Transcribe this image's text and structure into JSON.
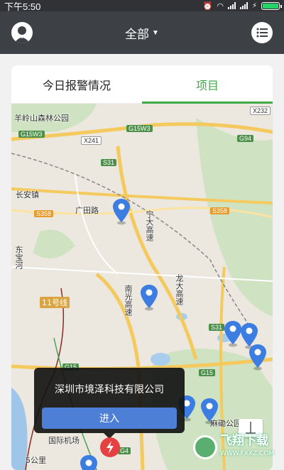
{
  "status_bar": {
    "time": "下午5:50"
  },
  "app_bar": {
    "title": "全部",
    "avatar_icon": "user-avatar-icon",
    "menu_icon": "list-icon"
  },
  "tabs": [
    {
      "label": "今日报警情况",
      "active": false
    },
    {
      "label": "项目",
      "active": true
    }
  ],
  "colors": {
    "accent": "#3fa84a",
    "appbar": "#3d4045",
    "button": "#4d7fd6",
    "pin": "#3b7de0",
    "alarm": "#e54042"
  },
  "map": {
    "labels": {
      "park": "羊岭山森林公园",
      "town": "长安镇",
      "road1": "广田路",
      "road2": "宁大高速",
      "road3": "南光高速",
      "road4": "龙大高速",
      "area": "东宝河",
      "metro": "11号线",
      "airport": "国际机场",
      "distance": "5公里",
      "place": "麻磡公园"
    },
    "shields": [
      "G15W3",
      "X241",
      "G15W3",
      "G94",
      "S31",
      "S358",
      "S358",
      "X232",
      "S31",
      "G15",
      "G15",
      "G4"
    ]
  },
  "popup": {
    "company": "深圳市境泽科技有限公司",
    "enter_label": "进入"
  },
  "watermark": {
    "text": "飞翔下载",
    "url": "WWW.FXXZ.COM"
  }
}
